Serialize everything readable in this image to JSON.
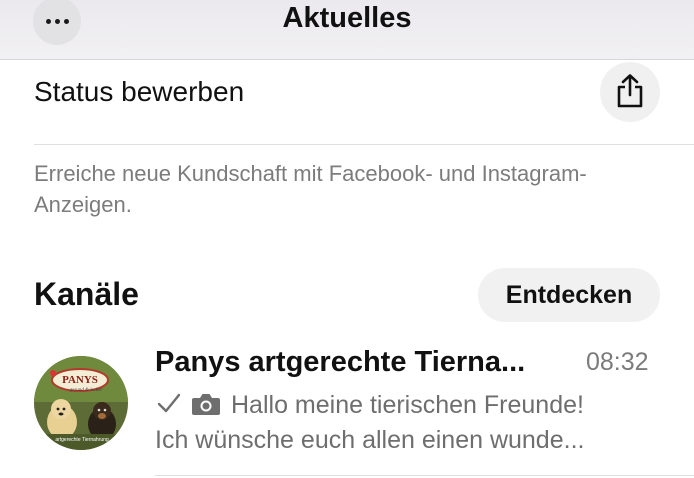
{
  "header": {
    "title": "Aktuelles",
    "more_icon": "more-horizontal-icon"
  },
  "status": {
    "label": "Status bewerben",
    "share_icon": "share-icon"
  },
  "promo": {
    "text": "Erreiche neue Kundschaft mit Facebook- und Instagram-Anzeigen."
  },
  "channels": {
    "title": "Kanäle",
    "discover_label": "Entdecken",
    "items": [
      {
        "name": "Panys artgerechte Tierna...",
        "time": "08:32",
        "status_icon": "check-icon",
        "media_icon": "camera-icon",
        "preview_line1": "Hallo meine tierischen Freunde!",
        "preview_line2": "Ich wünsche euch allen einen wunde...",
        "avatar_text": "PANYS",
        "avatar_subtext": "gesund & lecker",
        "avatar_footer": "artgerechte Tiernahrung"
      }
    ]
  },
  "colors": {
    "header_bg": "#eeedf0",
    "secondary_text": "#7c7c7c",
    "button_bg": "#f1f1f1"
  }
}
